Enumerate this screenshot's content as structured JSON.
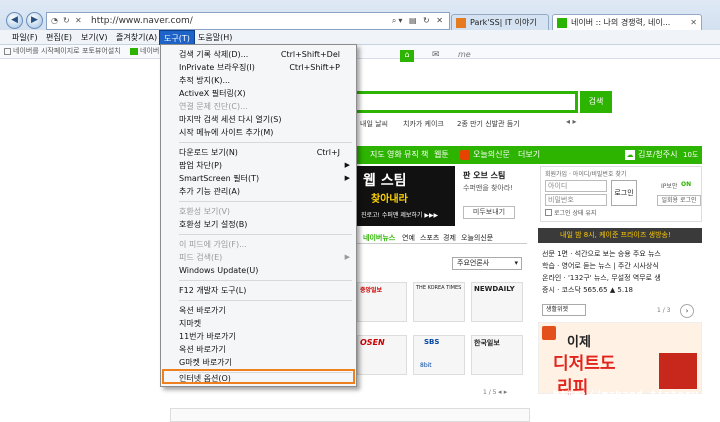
{
  "browser": {
    "address": "http://www.naver.com/",
    "tabs": [
      {
        "label": "Park'SS| IT 이야기"
      },
      {
        "label": "네이버 :: 나의 경쟁력, 네이..."
      }
    ]
  },
  "menubar": {
    "items": [
      {
        "label": "파일(F)"
      },
      {
        "label": "편집(E)"
      },
      {
        "label": "보기(V)"
      },
      {
        "label": "즐겨찾기(A)"
      },
      {
        "label": "도구(T)"
      },
      {
        "label": "도움말(H)"
      }
    ]
  },
  "favorites_bar": {
    "items": [
      {
        "label": "네이버를 시작페이지로"
      },
      {
        "label": "포토뷰어설치"
      },
      {
        "label": "네이버"
      }
    ]
  },
  "tools_menu": {
    "items": [
      {
        "label": "검색 기록 삭제(D)...",
        "shortcut": "Ctrl+Shift+Del"
      },
      {
        "label": "InPrivate 브라우징(I)",
        "shortcut": "Ctrl+Shift+P"
      },
      {
        "label": "추적 방지(K)..."
      },
      {
        "label": "ActiveX 필터링(X)"
      },
      {
        "label": "연결 문제 진단(C)..."
      },
      {
        "label": "마지막 검색 세션 다시 열기(S)"
      },
      {
        "label": "시작 메뉴에 사이트 추가(M)"
      },
      {
        "label": "다운로드 보기(N)",
        "shortcut": "Ctrl+J"
      },
      {
        "label": "팝업 차단(P)"
      },
      {
        "label": "SmartScreen 필터(T)"
      },
      {
        "label": "추가 기능 관리(A)"
      },
      {
        "label": "호환성 보기(V)"
      },
      {
        "label": "호환성 보기 설정(B)"
      },
      {
        "label": "이 피드에 가입(F)..."
      },
      {
        "label": "피드 검색(E)"
      },
      {
        "label": "Windows Update(U)"
      },
      {
        "label": "F12 개발자 도구(L)"
      },
      {
        "label": "옥션 바로가기"
      },
      {
        "label": "지마켓"
      },
      {
        "label": "11번가 바로가기"
      },
      {
        "label": "옥션 바로가기"
      },
      {
        "label": "G마켓 바로가기"
      },
      {
        "label": "인터넷 옵션(O)"
      }
    ]
  },
  "naver": {
    "search_button": "검색",
    "me": "me",
    "keywords": [
      "내일 날씨",
      "치카가 케이크",
      "2종 만기 신발관 듬기"
    ],
    "gnb": [
      "지도",
      "영화",
      "뮤직",
      "책",
      "웹툰"
    ],
    "gnb_extra": [
      "오늘의신문",
      "더보기"
    ],
    "weather_city": "김포/청주시",
    "weather_temp": "10도",
    "login": {
      "top": "회원가입 · 아이디/비밀번호 찾기",
      "id": "아이디",
      "pw": "비밀번호",
      "btn": "로그인",
      "keep": "로그인 상태 유지",
      "ip": "IP보안",
      "ip_state": "ON",
      "onetime": "일회용 로그인"
    },
    "ad_title": "웹 스팀",
    "ad_sub": "찾아내라",
    "ad_caption": "진로고! 수퍼맨 제보하기 ▶▶▶",
    "ad_side": [
      "판 오브 스팀",
      "수퍼맨을 찾아라!"
    ],
    "ad_btn": "미두보내기",
    "news_tabs": [
      "네이버뉴스",
      "연예",
      "스포츠",
      "경제",
      "오늘의신문"
    ],
    "press_select": "주요언론사",
    "press_list": [
      "중앙일보",
      "THE KOREA TIMES",
      "NEWDAILY",
      "OSEN",
      "SBS",
      "한국일보",
      "8bit"
    ],
    "page_ind_left": "1 / 5",
    "page_ind_right": "1 / 3",
    "banner": "내일 밤 8시, 케이준 프라이즈 생방송!",
    "news_items": [
      "선문 1면 · 석간으로 보는 승용 주요 뉴스",
      "학습 · 영어로 듣는 뉴스 | 주간 시사상식",
      "온라인 · '132구' 뉴스, 무설정 역무로 생",
      "증시 · 코스닥 565.65 ▲ 5.18"
    ],
    "life_select": "생활위젯",
    "dessert": [
      "이제",
      "디저트도",
      "리피"
    ]
  },
  "watermark": "http://makand.tistory.com"
}
